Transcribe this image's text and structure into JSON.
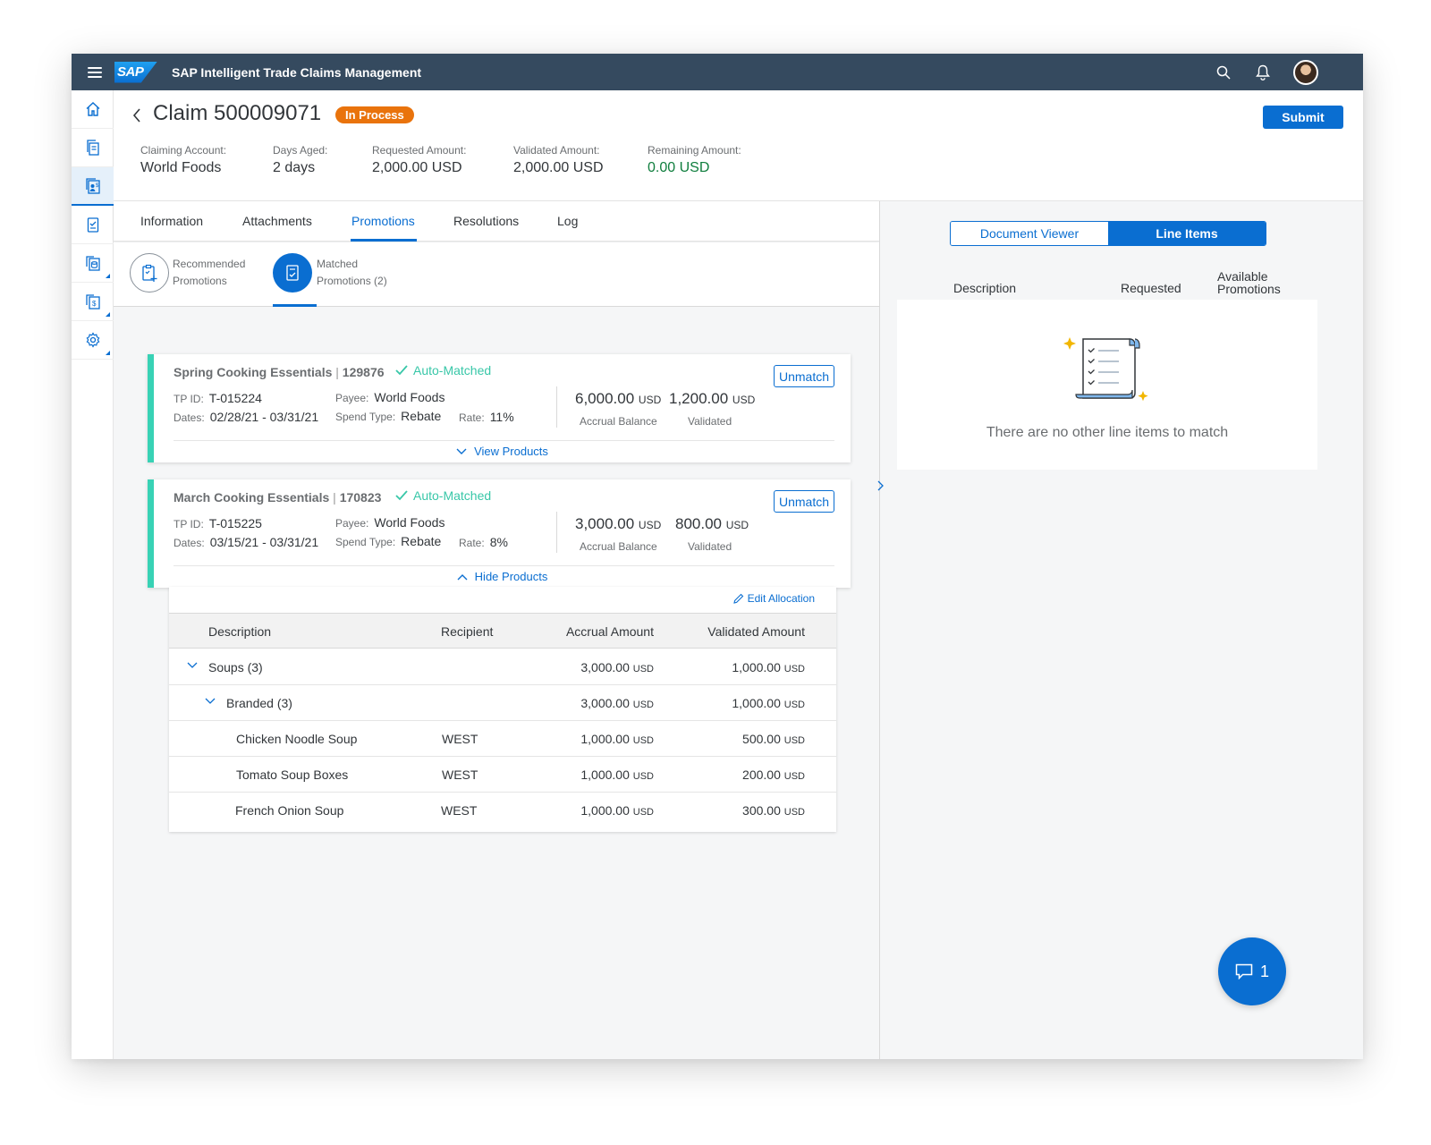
{
  "shell": {
    "logo_text": "SAP",
    "app_title": "SAP Intelligent Trade Claims Management"
  },
  "sidenav": {
    "items": [
      {
        "icon": "home-icon"
      },
      {
        "icon": "documents-icon"
      },
      {
        "icon": "claim-account-icon",
        "active": true
      },
      {
        "icon": "checklist-icon"
      },
      {
        "icon": "promotions-icon"
      },
      {
        "icon": "settlement-icon"
      },
      {
        "icon": "settings-icon"
      }
    ]
  },
  "header": {
    "title": "Claim 500009071",
    "status": "In Process",
    "submit_label": "Submit",
    "kpis": [
      {
        "label": "Claiming Account:",
        "value": "World Foods"
      },
      {
        "label": "Days Aged:",
        "value": "2 days"
      },
      {
        "label": "Requested Amount:",
        "value": "2,000.00 USD"
      },
      {
        "label": "Validated Amount:",
        "value": "2,000.00 USD"
      },
      {
        "label": "Remaining Amount:",
        "value": "0.00 USD"
      }
    ]
  },
  "tabs": [
    {
      "label": "Information"
    },
    {
      "label": "Attachments"
    },
    {
      "label": "Promotions",
      "active": true
    },
    {
      "label": "Resolutions"
    },
    {
      "label": "Log"
    }
  ],
  "subtabs": [
    {
      "line1": "Recommended",
      "line2": "Promotions"
    },
    {
      "line1": "Matched",
      "line2": "Promotions (2)",
      "active": true
    }
  ],
  "promotions": [
    {
      "name": "Spring Cooking Essentials",
      "sep": "|",
      "id": "129876",
      "match_status": "Auto-Matched",
      "tp_id_label": "TP ID:",
      "tp_id": "T-015224",
      "dates_label": "Dates:",
      "dates": "02/28/21 - 03/31/21",
      "payee_label": "Payee:",
      "payee": "World Foods",
      "spend_type_label": "Spend Type:",
      "spend_type": "Rebate",
      "rate_label": "Rate:",
      "rate": "11%",
      "accrual_amount": "6,000.00",
      "accrual_currency": "USD",
      "accrual_label": "Accrual Balance",
      "validated_amount": "1,200.00",
      "validated_currency": "USD",
      "validated_label": "Validated",
      "unmatch_label": "Unmatch",
      "toggle_label": "View Products"
    },
    {
      "name": "March Cooking Essentials",
      "sep": "|",
      "id": "170823",
      "match_status": "Auto-Matched",
      "tp_id_label": "TP ID:",
      "tp_id": "T-015225",
      "dates_label": "Dates:",
      "dates": "03/15/21 - 03/31/21",
      "payee_label": "Payee:",
      "payee": "World Foods",
      "spend_type_label": "Spend Type:",
      "spend_type": "Rebate",
      "rate_label": "Rate:",
      "rate": "8%",
      "accrual_amount": "3,000.00",
      "accrual_currency": "USD",
      "accrual_label": "Accrual Balance",
      "validated_amount": "800.00",
      "validated_currency": "USD",
      "validated_label": "Validated",
      "unmatch_label": "Unmatch",
      "toggle_label": "Hide Products"
    }
  ],
  "products": {
    "edit_label": "Edit Allocation",
    "columns": [
      "Description",
      "Recipient",
      "Accrual Amount",
      "Validated Amount"
    ],
    "rows": [
      {
        "description": "Soups (3)",
        "recipient": "",
        "accrual": "3,000.00",
        "validated": "1,000.00",
        "currency": "USD"
      },
      {
        "description": "Branded (3)",
        "recipient": "",
        "accrual": "3,000.00",
        "validated": "1,000.00",
        "currency": "USD"
      },
      {
        "description": "Chicken Noodle Soup",
        "recipient": "WEST",
        "accrual": "1,000.00",
        "validated": "500.00",
        "currency": "USD"
      },
      {
        "description": "Tomato Soup Boxes",
        "recipient": "WEST",
        "accrual": "1,000.00",
        "validated": "200.00",
        "currency": "USD"
      },
      {
        "description": "French Onion Soup",
        "recipient": "WEST",
        "accrual": "1,000.00",
        "validated": "300.00",
        "currency": "USD"
      }
    ]
  },
  "right_pane": {
    "segments": [
      {
        "label": "Document Viewer"
      },
      {
        "label": "Line Items",
        "active": true
      }
    ],
    "columns": {
      "description": "Description",
      "requested": "Requested",
      "available_line1": "Available",
      "available_line2": "Promotions"
    },
    "empty_text": "There are no other line items to match"
  },
  "fab": {
    "count": "1"
  },
  "colors": {
    "shell": "#354a5f",
    "brand": "#0a6ed1",
    "status_orange": "#e9730c",
    "positive": "#107e3e",
    "match_teal": "#38d2b5"
  }
}
